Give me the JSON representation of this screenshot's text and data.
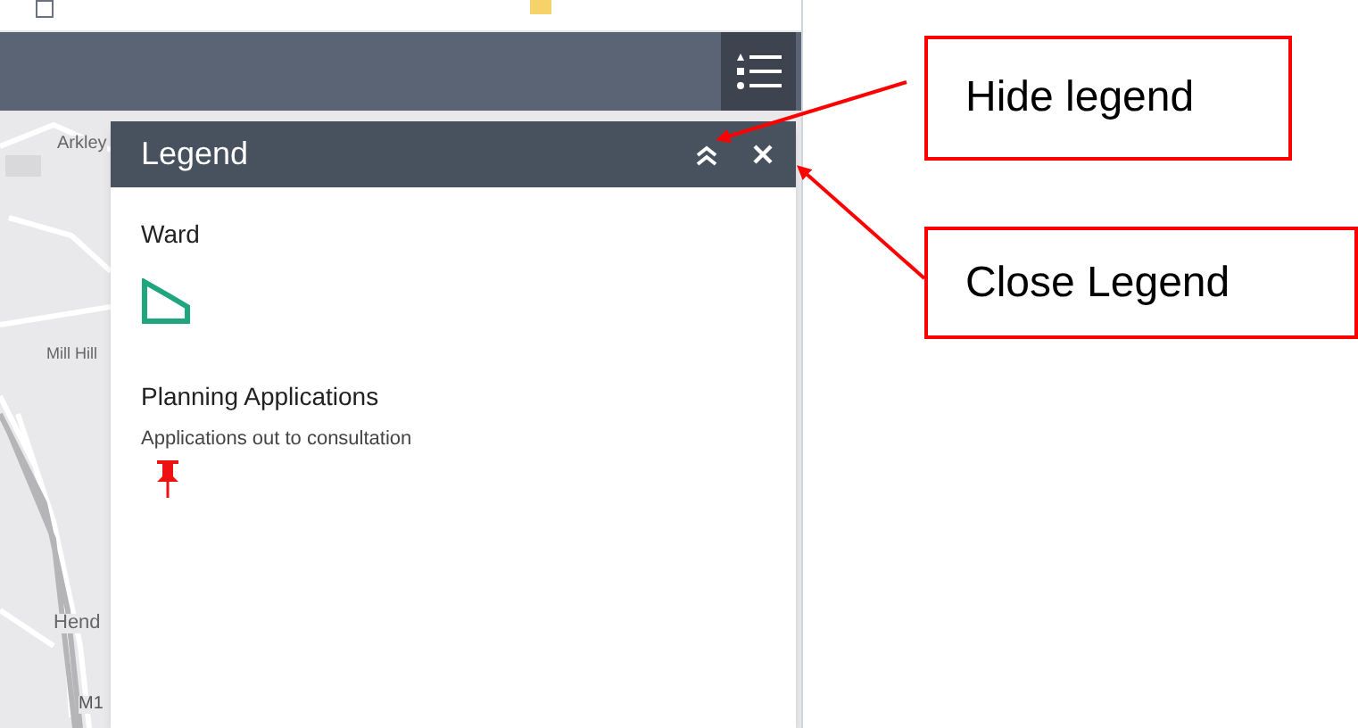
{
  "map": {
    "labels": [
      {
        "text": "Arkley",
        "kind": "place"
      },
      {
        "text": "Mill Hill",
        "kind": "place"
      },
      {
        "text": "Hend",
        "kind": "place"
      },
      {
        "text": "M1",
        "kind": "road"
      }
    ]
  },
  "legend": {
    "title": "Legend",
    "layers": [
      {
        "title": "Ward",
        "kind": "polygon"
      },
      {
        "title": "Planning Applications",
        "kind": "pin",
        "label": "Applications out to consultation"
      }
    ]
  },
  "callouts": [
    {
      "text": "Hide legend"
    },
    {
      "text": "Close Legend"
    }
  ]
}
